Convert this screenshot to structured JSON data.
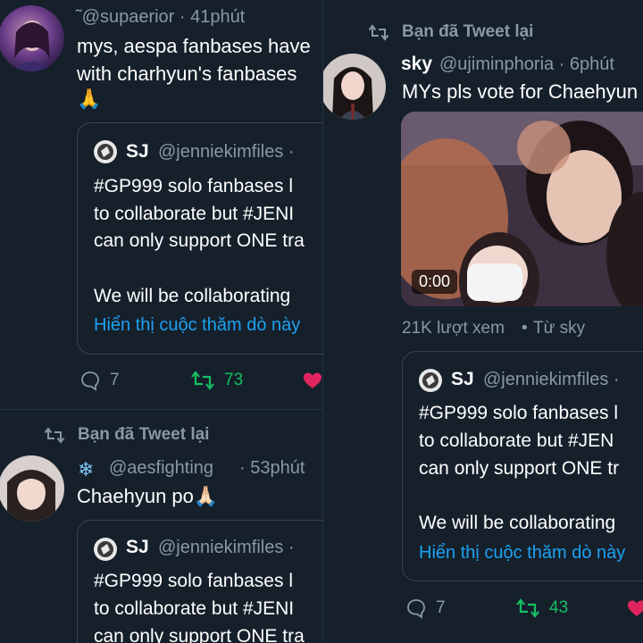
{
  "left": {
    "tweet1": {
      "handle_time": "˜@supaerior · 41phút",
      "lines": [
        "mys, aespa fanbases have",
        "with charhyun's fanbases"
      ],
      "emoji": "🙏",
      "quote": {
        "author_name": "SJ",
        "author_handle": "@jenniekimfiles ·",
        "lines": [
          "#GP999 solo fanbases l",
          "to collaborate but #JENI",
          "can only support ONE tra"
        ],
        "line_extra": "We will be collaborating",
        "poll_link": "Hiển thị cuộc thăm dò này"
      },
      "reply_count": "7",
      "retweet_count": "73"
    },
    "retweet_banner": "Bạn đã Tweet lại",
    "tweet2": {
      "handle": "@aesfighting",
      "time": "· 53phút",
      "text": "Chaehyun po🙏🏻",
      "quote": {
        "author_name": "SJ",
        "author_handle": "@jenniekimfiles ·",
        "lines": [
          "#GP999 solo fanbases l",
          "to collaborate but #JENI",
          "can only support ONE tra"
        ]
      }
    }
  },
  "right": {
    "retweet_banner": "Bạn đã Tweet lại",
    "tweet": {
      "name": "sky",
      "handle_time": "@ujiminphoria · 6phút",
      "text": "MYs pls vote for Chaehyun",
      "video_time": "0:00",
      "views": "21K lượt xem",
      "views_from": "Từ sky",
      "quote": {
        "author_name": "SJ",
        "author_handle": "@jenniekimfiles ·",
        "lines": [
          "#GP999 solo fanbases l",
          "to collaborate but #JEN",
          "can only support ONE tr"
        ],
        "line_extra": "We will be collaborating",
        "poll_link": "Hiển thị cuộc thăm dò này"
      },
      "reply_count": "7",
      "retweet_count": "43"
    }
  },
  "colors": {
    "background": "#15202b",
    "muted": "#8899a6",
    "link": "#1da1f2",
    "retweet": "#17bf63",
    "like": "#e0245e"
  }
}
